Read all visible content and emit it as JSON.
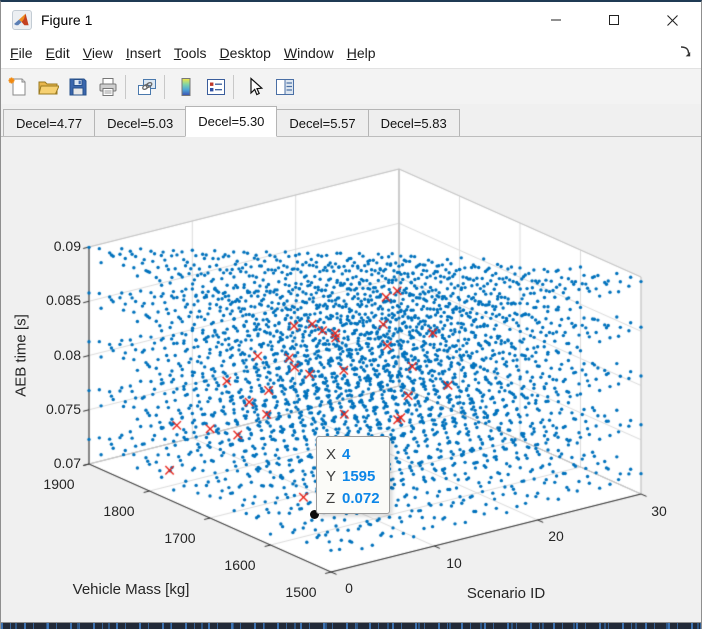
{
  "window": {
    "title": "Figure 1",
    "controls": {
      "minimize": "minimize",
      "maximize": "maximize",
      "close": "close"
    }
  },
  "menu": {
    "items": [
      {
        "m": "F",
        "rest": "ile"
      },
      {
        "m": "E",
        "rest": "dit"
      },
      {
        "m": "V",
        "rest": "iew"
      },
      {
        "m": "I",
        "rest": "nsert"
      },
      {
        "m": "T",
        "rest": "ools"
      },
      {
        "m": "D",
        "rest": "esktop"
      },
      {
        "m": "W",
        "rest": "indow"
      },
      {
        "m": "H",
        "rest": "elp"
      }
    ]
  },
  "toolbar": {
    "icons": [
      "new-figure",
      "open-file",
      "save-figure",
      "print-figure",
      "link-plot",
      "insert-colorbar",
      "insert-legend",
      "edit-plot",
      "property-inspector"
    ]
  },
  "tabs": {
    "items": [
      "Decel=4.77",
      "Decel=5.03",
      "Decel=5.30",
      "Decel=5.57",
      "Decel=5.83"
    ],
    "active_index": 2
  },
  "chart_data": {
    "type": "scatter",
    "projection": "3d",
    "xlabel": "Scenario ID",
    "ylabel": "Vehicle Mass [kg]",
    "zlabel": "AEB time [s]",
    "xlim": [
      0,
      30
    ],
    "ylim": [
      1500,
      1900
    ],
    "zlim": [
      0.07,
      0.09
    ],
    "xticks": [
      "0",
      "10",
      "20",
      "30"
    ],
    "yticks": [
      "1900",
      "1800",
      "1700",
      "1600",
      "1500"
    ],
    "zticks": [
      "0.09",
      "0.085",
      "0.08",
      "0.075",
      "0.07"
    ],
    "grid": true,
    "series": [
      {
        "name": "aeb-time-samples",
        "marker": "point",
        "color": "#0072BD",
        "x_range": [
          0,
          30
        ],
        "x_step": 1,
        "y_range": [
          1500,
          1900
        ],
        "y_step": 20,
        "z_levels": [
          0.072,
          0.0765,
          0.081,
          0.0855,
          0.0897
        ]
      },
      {
        "name": "flagged-samples",
        "marker": "x",
        "color": "#E8261D",
        "points": [
          [
            17,
            1681,
            4
          ],
          [
            13,
            1631,
            4
          ],
          [
            18,
            1721,
            3
          ],
          [
            11,
            1749,
            3
          ],
          [
            11,
            1719,
            3
          ],
          [
            12,
            1719,
            3
          ],
          [
            13,
            1715,
            3
          ],
          [
            10,
            1663,
            3
          ],
          [
            14,
            1646,
            3
          ],
          [
            16,
            1605,
            3
          ],
          [
            10,
            1792,
            2
          ],
          [
            12,
            1774,
            2
          ],
          [
            14,
            1718,
            2
          ],
          [
            10,
            1731,
            2
          ],
          [
            9,
            1689,
            2
          ],
          [
            18,
            1673,
            2
          ],
          [
            17,
            1597,
            2
          ],
          [
            10,
            1843,
            1
          ],
          [
            12,
            1808,
            1
          ],
          [
            9,
            1789,
            1
          ],
          [
            14,
            1717,
            1
          ],
          [
            8,
            1743,
            1
          ],
          [
            4,
            1768,
            1
          ],
          [
            16,
            1658,
            1
          ],
          [
            1,
            1772,
            1
          ],
          [
            20,
            1714,
            1
          ],
          [
            16,
            1663,
            1
          ],
          [
            10,
            1825,
            0
          ],
          [
            2,
            1801,
            0
          ],
          [
            6,
            1648,
            0
          ]
        ]
      }
    ],
    "selected_point": {
      "x": 4,
      "y": 1595,
      "z": 0.072
    }
  },
  "datatip": {
    "rows": [
      {
        "label": "X",
        "value": "4"
      },
      {
        "label": "Y",
        "value": "1595"
      },
      {
        "label": "Z",
        "value": "0.072"
      }
    ],
    "value_color": "#0C86E8"
  },
  "colors": {
    "dot_blue": "#0072BD",
    "marker_red": "#E8261D",
    "figure_background": "#F0F0F0",
    "axes_wall": "#FFFFFF",
    "grid_line": "#DCDCDC",
    "axis_line": "#333333"
  }
}
